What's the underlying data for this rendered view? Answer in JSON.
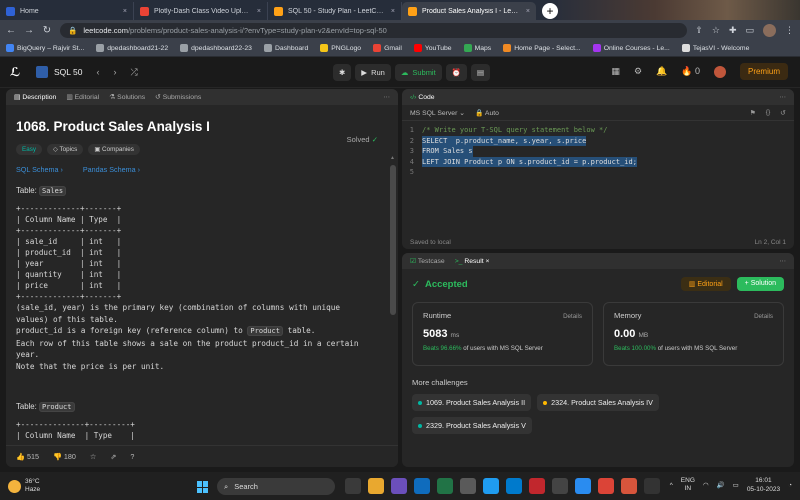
{
  "browser": {
    "tabs": [
      {
        "label": "Home",
        "color": "#2f62d6",
        "active": false
      },
      {
        "label": "Plotly-Dash Class Video Uploads",
        "color": "#ea4335",
        "active": false
      },
      {
        "label": "SQL 50 - Study Plan - LeetCode",
        "color": "#ffa116",
        "active": false
      },
      {
        "label": "Product Sales Analysis I - LeetCode",
        "color": "#ffa116",
        "active": true
      }
    ],
    "url_host": "leetcode.com",
    "url_path": "/problems/product-sales-analysis-i/?envType=study-plan-v2&envId=top-sql-50",
    "bookmarks": [
      {
        "label": "BigQuery – Rajvir St...",
        "color": "#4285f4"
      },
      {
        "label": "dpedashboard21-22",
        "color": "#9aa0a6"
      },
      {
        "label": "dpedashboard22-23",
        "color": "#9aa0a6"
      },
      {
        "label": "Dashboard",
        "color": "#9aa0a6"
      },
      {
        "label": "PNGLogo",
        "color": "#f5c518"
      },
      {
        "label": "Gmail",
        "color": "#ea4335"
      },
      {
        "label": "YouTube",
        "color": "#ff0000"
      },
      {
        "label": "Maps",
        "color": "#34a853"
      },
      {
        "label": "Home Page - Select...",
        "color": "#f08a24"
      },
      {
        "label": "Online Courses - Le...",
        "color": "#a435f0"
      },
      {
        "label": "TejasVI - Welcome",
        "color": "#dddddd"
      }
    ]
  },
  "header": {
    "list_name": "SQL 50",
    "run_label": "Run",
    "submit_label": "Submit",
    "streak": "0",
    "premium_label": "Premium"
  },
  "description": {
    "tabs": [
      "Description",
      "Editorial",
      "Solutions",
      "Submissions"
    ],
    "title": "1068. Product Sales Analysis I",
    "solved_label": "Solved",
    "chips": [
      "Easy",
      "Topics",
      "Companies"
    ],
    "schema_links": [
      "SQL Schema",
      "Pandas Schema"
    ],
    "table_label": "Table:",
    "table1_name": "Sales",
    "table1_ascii": "+-------------+-------+\n| Column Name | Type  |\n+-------------+-------+\n| sale_id     | int   |\n| product_id  | int   |\n| year        | int   |\n| quantity    | int   |\n| price       | int   |\n+-------------+-------+",
    "para1": "(sale_id, year) is the primary key (combination of columns with unique values) of this table.",
    "para2_pre": "product_id is a foreign key (reference column) to ",
    "para2_code": "Product",
    "para2_post": " table.",
    "para3": "Each row of this table shows a sale on the product product_id in a certain year.",
    "para4": "Note that the price is per unit.",
    "table2_name": "Product",
    "table2_ascii": "+--------------+---------+\n| Column Name  | Type    |",
    "likes": "515",
    "dislikes": "180"
  },
  "code": {
    "tab_label": "Code",
    "language": "MS SQL Server",
    "auto_label": "Auto",
    "lines": [
      {
        "n": "1",
        "text": "/* Write your T-SQL query statement below */"
      },
      {
        "n": "2",
        "text": "SELECT  p.product_name, s.year, s.price"
      },
      {
        "n": "3",
        "text": "FROM Sales s"
      },
      {
        "n": "4",
        "text": "LEFT JOIN Product p ON s.product_id = p.product_id;"
      },
      {
        "n": "5",
        "text": ""
      }
    ],
    "status": "Saved to local",
    "cursor": "Ln 2, Col 1"
  },
  "result": {
    "tabs": [
      "Testcase",
      "Result"
    ],
    "status": "Accepted",
    "editorial_label": "Editorial",
    "solution_label": "Solution",
    "runtime": {
      "label": "Runtime",
      "details": "Details",
      "value": "5083",
      "unit": "ms",
      "beats": "Beats 96.66%",
      "beats_text": "of users with MS SQL Server"
    },
    "memory": {
      "label": "Memory",
      "details": "Details",
      "value": "0.00",
      "unit": "MB",
      "beats": "Beats 100.00%",
      "beats_text": "of users with MS SQL Server"
    },
    "more_label": "More challenges",
    "challenges": [
      {
        "label": "1069. Product Sales Analysis II",
        "color": "#00b8a3"
      },
      {
        "label": "2324. Product Sales Analysis IV",
        "color": "#ffb800"
      },
      {
        "label": "2329. Product Sales Analysis V",
        "color": "#00b8a3"
      }
    ]
  },
  "taskbar": {
    "temp": "36°C",
    "weather": "Haze",
    "search": "Search",
    "lang1": "ENG",
    "lang2": "IN",
    "time": "16:01",
    "date": "05-10-2023"
  }
}
